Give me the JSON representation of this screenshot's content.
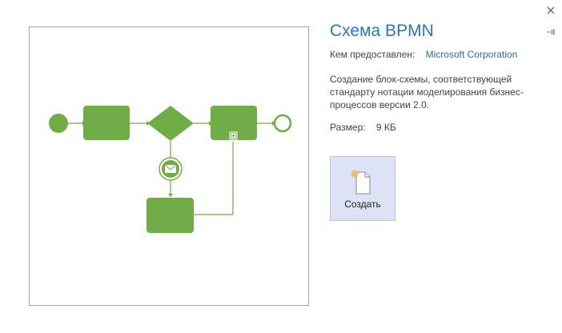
{
  "title": "Схема BPMN",
  "provided_by_label": "Кем предоставлен:",
  "provided_by_value": "Microsoft Corporation",
  "description": "Создание блок-схемы, соответствующей стандарту нотации моделирования бизнес-процессов версии 2.0.",
  "size_label": "Размер:",
  "size_value": "9 КБ",
  "create_label": "Создать",
  "colors": {
    "accent": "#2e75b6",
    "diagram_green": "#70ad47",
    "create_bg": "#dde3f7"
  },
  "icons": [
    "close-icon",
    "pin-icon",
    "new-document-icon",
    "envelope-icon",
    "plus-box-icon"
  ]
}
